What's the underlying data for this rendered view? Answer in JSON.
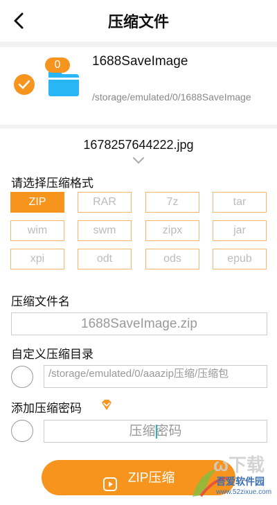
{
  "header": {
    "title": "压缩文件"
  },
  "source": {
    "folder_name": "1688SaveImage",
    "folder_path": "/storage/emulated/0/1688SaveImage",
    "count": "0",
    "file_name": "1678257644222.jpg"
  },
  "format_section": {
    "label": "请选择压缩格式",
    "selected": "ZIP",
    "formats": [
      "ZIP",
      "RAR",
      "7z",
      "tar",
      "wim",
      "swm",
      "zipx",
      "jar",
      "xpi",
      "odt",
      "ods",
      "epub"
    ]
  },
  "filename_section": {
    "label": "压缩文件名",
    "value": "1688SaveImage.zip"
  },
  "directory_section": {
    "label": "自定义压缩目录",
    "value": "/storage/emulated/0/aaazip压缩/压缩包"
  },
  "password_section": {
    "label": "添加压缩密码",
    "placeholder": "压缩密码"
  },
  "action": {
    "button_label": "ZIP压缩"
  },
  "watermark": {
    "site_name": "吾爱软件园",
    "url": "www.52zixue.com"
  },
  "colors": {
    "accent": "#f7941d",
    "folder": "#29b6f6"
  }
}
